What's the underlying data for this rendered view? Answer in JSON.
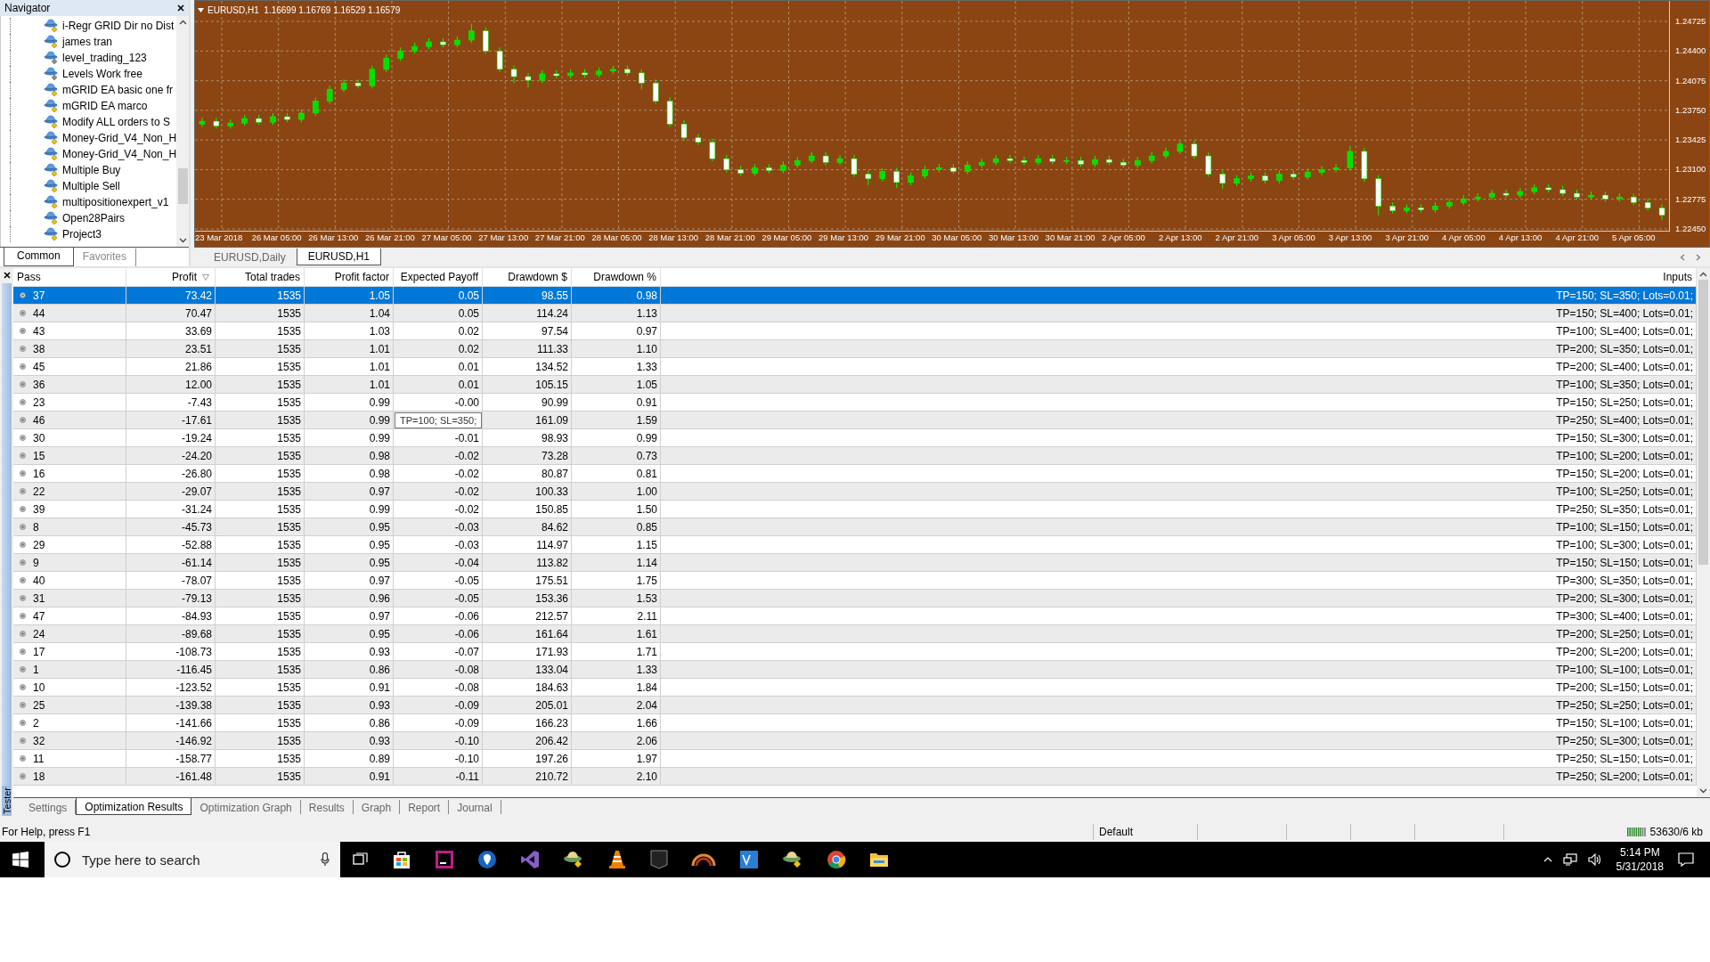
{
  "navigator": {
    "title": "Navigator",
    "items": [
      {
        "label": "i-Regr GRID Dir no Dist",
        "color": "#f2c200"
      },
      {
        "label": "james tran",
        "color": "#f2c200"
      },
      {
        "label": "level_trading_123",
        "color": "#8c8c8c"
      },
      {
        "label": "Levels Work free",
        "color": "#8c8c8c"
      },
      {
        "label": "mGRID EA basic one fr",
        "color": "#f2c200"
      },
      {
        "label": "mGRID EA marco",
        "color": "#f2c200"
      },
      {
        "label": "Modify ALL orders to S",
        "color": "#f2c200"
      },
      {
        "label": "Money-Grid_V4_Non_H",
        "color": "#f2c200"
      },
      {
        "label": "Money-Grid_V4_Non_H",
        "color": "#f2c200"
      },
      {
        "label": "Multiple Buy",
        "color": "#f2c200"
      },
      {
        "label": "Multiple Sell",
        "color": "#f2c200"
      },
      {
        "label": "multipositionexpert_v1",
        "color": "#f2c200"
      },
      {
        "label": "Open28Pairs",
        "color": "#f2c200"
      },
      {
        "label": "Project3",
        "color": "#f2c200"
      }
    ],
    "tabs": [
      {
        "label": "Common",
        "selected": true
      },
      {
        "label": "Favorites",
        "selected": false
      }
    ]
  },
  "chart": {
    "chart_data": {
      "type": "candlestick",
      "title": "EURUSD,H1  1.16699 1.16769 1.16529 1.16579",
      "ylim": [
        1.2245,
        1.2495
      ],
      "yticks": [
        {
          "value": 1.24725,
          "label": "1.24725"
        },
        {
          "value": 1.244,
          "label": "1.24400"
        },
        {
          "value": 1.24075,
          "label": "1.24075"
        },
        {
          "value": 1.2375,
          "label": "1.23750"
        },
        {
          "value": 1.23425,
          "label": "1.23425"
        },
        {
          "value": 1.231,
          "label": "1.23100"
        },
        {
          "value": 1.22775,
          "label": "1.22775"
        },
        {
          "value": 1.2245,
          "label": "1.22450"
        }
      ],
      "grid": true,
      "ohlc": [
        [
          1.236,
          1.2367,
          1.2357,
          1.2363
        ],
        [
          1.2363,
          1.2367,
          1.2355,
          1.2358
        ],
        [
          1.2358,
          1.2365,
          1.2355,
          1.2361
        ],
        [
          1.2361,
          1.237,
          1.2358,
          1.2366
        ],
        [
          1.2366,
          1.237,
          1.2359,
          1.2362
        ],
        [
          1.2362,
          1.2372,
          1.2359,
          1.2368
        ],
        [
          1.2368,
          1.2372,
          1.2362,
          1.2365
        ],
        [
          1.2365,
          1.2376,
          1.2362,
          1.2372
        ],
        [
          1.2372,
          1.2389,
          1.2369,
          1.2385
        ],
        [
          1.2385,
          1.2402,
          1.2382,
          1.2398
        ],
        [
          1.2398,
          1.2409,
          1.2395,
          1.2405
        ],
        [
          1.2405,
          1.2409,
          1.2399,
          1.2402
        ],
        [
          1.2402,
          1.2424,
          1.2399,
          1.242
        ],
        [
          1.242,
          1.2436,
          1.2417,
          1.2432
        ],
        [
          1.2432,
          1.2444,
          1.2429,
          1.244
        ],
        [
          1.244,
          1.2449,
          1.2437,
          1.2445
        ],
        [
          1.2445,
          1.2454,
          1.2442,
          1.245
        ],
        [
          1.245,
          1.2454,
          1.2444,
          1.2447
        ],
        [
          1.2447,
          1.2456,
          1.2444,
          1.2452
        ],
        [
          1.2452,
          1.247,
          1.2449,
          1.2462
        ],
        [
          1.2462,
          1.2466,
          1.2437,
          1.244
        ],
        [
          1.244,
          1.2444,
          1.2417,
          1.242
        ],
        [
          1.242,
          1.2424,
          1.2405,
          1.2412
        ],
        [
          1.2412,
          1.2416,
          1.24,
          1.2408
        ],
        [
          1.2408,
          1.2419,
          1.2405,
          1.2415
        ],
        [
          1.2415,
          1.2419,
          1.241,
          1.2413
        ],
        [
          1.2413,
          1.242,
          1.241,
          1.2416
        ],
        [
          1.2416,
          1.242,
          1.2411,
          1.2414
        ],
        [
          1.2414,
          1.2422,
          1.2411,
          1.2418
        ],
        [
          1.2418,
          1.2424,
          1.2415,
          1.242
        ],
        [
          1.242,
          1.2424,
          1.2413,
          1.2416
        ],
        [
          1.2416,
          1.242,
          1.2398,
          1.2405
        ],
        [
          1.2405,
          1.2409,
          1.2382,
          1.2385
        ],
        [
          1.2385,
          1.2389,
          1.2357,
          1.236
        ],
        [
          1.236,
          1.2364,
          1.2342,
          1.2345
        ],
        [
          1.2345,
          1.2349,
          1.2337,
          1.234
        ],
        [
          1.234,
          1.2344,
          1.2319,
          1.2322
        ],
        [
          1.2322,
          1.2326,
          1.2307,
          1.231
        ],
        [
          1.231,
          1.2314,
          1.2303,
          1.2306
        ],
        [
          1.2306,
          1.2316,
          1.2303,
          1.2312
        ],
        [
          1.2312,
          1.2316,
          1.2306,
          1.2309
        ],
        [
          1.2309,
          1.2319,
          1.2306,
          1.2315
        ],
        [
          1.2315,
          1.2324,
          1.2312,
          1.232
        ],
        [
          1.232,
          1.2329,
          1.2317,
          1.2325
        ],
        [
          1.2325,
          1.2329,
          1.2315,
          1.2318
        ],
        [
          1.2318,
          1.2326,
          1.2315,
          1.2322
        ],
        [
          1.2322,
          1.2326,
          1.2302,
          1.2305
        ],
        [
          1.2305,
          1.2309,
          1.2293,
          1.23
        ],
        [
          1.23,
          1.2312,
          1.2297,
          1.2308
        ],
        [
          1.2308,
          1.2312,
          1.229,
          1.2296
        ],
        [
          1.2296,
          1.2307,
          1.2293,
          1.2303
        ],
        [
          1.2303,
          1.2314,
          1.23,
          1.231
        ],
        [
          1.231,
          1.2316,
          1.2307,
          1.2312
        ],
        [
          1.2312,
          1.2316,
          1.2305,
          1.2308
        ],
        [
          1.2308,
          1.2319,
          1.2305,
          1.2315
        ],
        [
          1.2315,
          1.2322,
          1.2312,
          1.2318
        ],
        [
          1.2318,
          1.2326,
          1.2315,
          1.2322
        ],
        [
          1.2322,
          1.2326,
          1.2317,
          1.232
        ],
        [
          1.232,
          1.2324,
          1.2315,
          1.2318
        ],
        [
          1.2318,
          1.2326,
          1.2315,
          1.2322
        ],
        [
          1.2322,
          1.2326,
          1.2316,
          1.2319
        ],
        [
          1.2319,
          1.2324,
          1.2316,
          1.232
        ],
        [
          1.232,
          1.2324,
          1.2313,
          1.2316
        ],
        [
          1.2316,
          1.2325,
          1.2313,
          1.2321
        ],
        [
          1.2321,
          1.2325,
          1.2315,
          1.2318
        ],
        [
          1.2318,
          1.2322,
          1.2312,
          1.2315
        ],
        [
          1.2315,
          1.2324,
          1.2312,
          1.232
        ],
        [
          1.232,
          1.2329,
          1.2317,
          1.2325
        ],
        [
          1.2325,
          1.2334,
          1.2322,
          1.233
        ],
        [
          1.233,
          1.2342,
          1.2327,
          1.2338
        ],
        [
          1.2338,
          1.2342,
          1.2322,
          1.2325
        ],
        [
          1.2325,
          1.2329,
          1.2302,
          1.2305
        ],
        [
          1.2305,
          1.2309,
          1.2289,
          1.2295
        ],
        [
          1.2295,
          1.2304,
          1.2292,
          1.23
        ],
        [
          1.23,
          1.2307,
          1.2297,
          1.2303
        ],
        [
          1.2303,
          1.2307,
          1.2295,
          1.2298
        ],
        [
          1.2298,
          1.2309,
          1.2295,
          1.2305
        ],
        [
          1.2305,
          1.2309,
          1.2299,
          1.2302
        ],
        [
          1.2302,
          1.2311,
          1.2299,
          1.2307
        ],
        [
          1.2307,
          1.2314,
          1.2304,
          1.231
        ],
        [
          1.231,
          1.2316,
          1.2307,
          1.2312
        ],
        [
          1.2312,
          1.2336,
          1.2309,
          1.233
        ],
        [
          1.233,
          1.2334,
          1.2297,
          1.23
        ],
        [
          1.23,
          1.2304,
          1.226,
          1.227
        ],
        [
          1.227,
          1.2274,
          1.2262,
          1.2265
        ],
        [
          1.2265,
          1.2272,
          1.2262,
          1.2268
        ],
        [
          1.2268,
          1.2272,
          1.2263,
          1.2266
        ],
        [
          1.2266,
          1.2274,
          1.2263,
          1.227
        ],
        [
          1.227,
          1.2278,
          1.2267,
          1.2274
        ],
        [
          1.2274,
          1.2282,
          1.2271,
          1.2278
        ],
        [
          1.2278,
          1.2284,
          1.2275,
          1.228
        ],
        [
          1.228,
          1.2288,
          1.2277,
          1.2284
        ],
        [
          1.2284,
          1.2288,
          1.2279,
          1.2282
        ],
        [
          1.2282,
          1.229,
          1.2279,
          1.2286
        ],
        [
          1.2286,
          1.2294,
          1.2283,
          1.229
        ],
        [
          1.229,
          1.2294,
          1.2285,
          1.2288
        ],
        [
          1.2288,
          1.2292,
          1.2281,
          1.2284
        ],
        [
          1.2284,
          1.2288,
          1.2277,
          1.228
        ],
        [
          1.228,
          1.2286,
          1.2277,
          1.2282
        ],
        [
          1.2282,
          1.2286,
          1.2275,
          1.2278
        ],
        [
          1.2278,
          1.2284,
          1.2275,
          1.228
        ],
        [
          1.228,
          1.2284,
          1.2271,
          1.2274
        ],
        [
          1.2274,
          1.2278,
          1.2265,
          1.2268
        ],
        [
          1.2268,
          1.2272,
          1.2255,
          1.226
        ]
      ]
    },
    "time_labels": [
      "23 Mar 2018",
      "26 Mar 05:00",
      "26 Mar 13:00",
      "26 Mar 21:00",
      "27 Mar 05:00",
      "27 Mar 13:00",
      "27 Mar 21:00",
      "28 Mar 05:00",
      "28 Mar 13:00",
      "28 Mar 21:00",
      "29 Mar 05:00",
      "29 Mar 13:00",
      "29 Mar 21:00",
      "30 Mar 05:00",
      "30 Mar 13:00",
      "30 Mar 21:00",
      "2 Apr 05:00",
      "2 Apr 13:00",
      "2 Apr 21:00",
      "3 Apr 05:00",
      "3 Apr 13:00",
      "3 Apr 21:00",
      "4 Apr 05:00",
      "4 Apr 13:00",
      "4 Apr 21:00",
      "5 Apr 05:00"
    ],
    "tabs": [
      {
        "label": "EURUSD,Daily",
        "selected": false
      },
      {
        "label": "EURUSD,H1",
        "selected": true
      }
    ]
  },
  "tester": {
    "side_label": "Tester",
    "columns": [
      "Pass",
      "Profit",
      "Total trades",
      "Profit factor",
      "Expected Payoff",
      "Drawdown $",
      "Drawdown %",
      "Inputs"
    ],
    "rows": [
      {
        "selected": true,
        "cells": [
          "37",
          "73.42",
          "1535",
          "1.05",
          "0.05",
          "98.55",
          "0.98",
          "TP=150; SL=350; Lots=0.01;"
        ]
      },
      {
        "selected": false,
        "cells": [
          "44",
          "70.47",
          "1535",
          "1.04",
          "0.05",
          "114.24",
          "1.13",
          "TP=150; SL=400; Lots=0.01;"
        ]
      },
      {
        "selected": false,
        "cells": [
          "43",
          "33.69",
          "1535",
          "1.03",
          "0.02",
          "97.54",
          "0.97",
          "TP=100; SL=400; Lots=0.01;"
        ]
      },
      {
        "selected": false,
        "cells": [
          "38",
          "23.51",
          "1535",
          "1.01",
          "0.02",
          "111.33",
          "1.10",
          "TP=200; SL=350; Lots=0.01;"
        ]
      },
      {
        "selected": false,
        "cells": [
          "45",
          "21.86",
          "1535",
          "1.01",
          "0.01",
          "134.52",
          "1.33",
          "TP=200; SL=400; Lots=0.01;"
        ]
      },
      {
        "selected": false,
        "cells": [
          "36",
          "12.00",
          "1535",
          "1.01",
          "0.01",
          "105.15",
          "1.05",
          "TP=100; SL=350; Lots=0.01;"
        ]
      },
      {
        "selected": false,
        "cells": [
          "23",
          "-7.43",
          "1535",
          "0.99",
          "-0.00",
          "90.99",
          "0.91",
          "TP=150; SL=250; Lots=0.01;"
        ]
      },
      {
        "selected": false,
        "cells": [
          "46",
          "-17.61",
          "1535",
          "0.99",
          null,
          "161.09",
          "1.59",
          "TP=250; SL=400; Lots=0.01;"
        ]
      },
      {
        "selected": false,
        "cells": [
          "30",
          "-19.24",
          "1535",
          "0.99",
          "-0.01",
          "98.93",
          "0.99",
          "TP=150; SL=300; Lots=0.01;"
        ]
      },
      {
        "selected": false,
        "cells": [
          "15",
          "-24.20",
          "1535",
          "0.98",
          "-0.02",
          "73.28",
          "0.73",
          "TP=100; SL=200; Lots=0.01;"
        ]
      },
      {
        "selected": false,
        "cells": [
          "16",
          "-26.80",
          "1535",
          "0.98",
          "-0.02",
          "80.87",
          "0.81",
          "TP=150; SL=200; Lots=0.01;"
        ]
      },
      {
        "selected": false,
        "cells": [
          "22",
          "-29.07",
          "1535",
          "0.97",
          "-0.02",
          "100.33",
          "1.00",
          "TP=100; SL=250; Lots=0.01;"
        ]
      },
      {
        "selected": false,
        "cells": [
          "39",
          "-31.24",
          "1535",
          "0.99",
          "-0.02",
          "150.85",
          "1.50",
          "TP=250; SL=350; Lots=0.01;"
        ]
      },
      {
        "selected": false,
        "cells": [
          "8",
          "-45.73",
          "1535",
          "0.95",
          "-0.03",
          "84.62",
          "0.85",
          "TP=100; SL=150; Lots=0.01;"
        ]
      },
      {
        "selected": false,
        "cells": [
          "29",
          "-52.88",
          "1535",
          "0.95",
          "-0.03",
          "114.97",
          "1.15",
          "TP=100; SL=300; Lots=0.01;"
        ]
      },
      {
        "selected": false,
        "cells": [
          "9",
          "-61.14",
          "1535",
          "0.95",
          "-0.04",
          "113.82",
          "1.14",
          "TP=150; SL=150; Lots=0.01;"
        ]
      },
      {
        "selected": false,
        "cells": [
          "40",
          "-78.07",
          "1535",
          "0.97",
          "-0.05",
          "175.51",
          "1.75",
          "TP=300; SL=350; Lots=0.01;"
        ]
      },
      {
        "selected": false,
        "cells": [
          "31",
          "-79.13",
          "1535",
          "0.96",
          "-0.05",
          "153.36",
          "1.53",
          "TP=200; SL=300; Lots=0.01;"
        ]
      },
      {
        "selected": false,
        "cells": [
          "47",
          "-84.93",
          "1535",
          "0.97",
          "-0.06",
          "212.57",
          "2.11",
          "TP=300; SL=400; Lots=0.01;"
        ]
      },
      {
        "selected": false,
        "cells": [
          "24",
          "-89.68",
          "1535",
          "0.95",
          "-0.06",
          "161.64",
          "1.61",
          "TP=200; SL=250; Lots=0.01;"
        ]
      },
      {
        "selected": false,
        "cells": [
          "17",
          "-108.73",
          "1535",
          "0.93",
          "-0.07",
          "171.93",
          "1.71",
          "TP=200; SL=200; Lots=0.01;"
        ]
      },
      {
        "selected": false,
        "cells": [
          "1",
          "-116.45",
          "1535",
          "0.86",
          "-0.08",
          "133.04",
          "1.33",
          "TP=100; SL=100; Lots=0.01;"
        ]
      },
      {
        "selected": false,
        "cells": [
          "10",
          "-123.52",
          "1535",
          "0.91",
          "-0.08",
          "184.63",
          "1.84",
          "TP=200; SL=150; Lots=0.01;"
        ]
      },
      {
        "selected": false,
        "cells": [
          "25",
          "-139.38",
          "1535",
          "0.93",
          "-0.09",
          "205.01",
          "2.04",
          "TP=250; SL=250; Lots=0.01;"
        ]
      },
      {
        "selected": false,
        "cells": [
          "2",
          "-141.66",
          "1535",
          "0.86",
          "-0.09",
          "166.23",
          "1.66",
          "TP=150; SL=100; Lots=0.01;"
        ]
      },
      {
        "selected": false,
        "cells": [
          "32",
          "-146.92",
          "1535",
          "0.93",
          "-0.10",
          "206.42",
          "2.06",
          "TP=250; SL=300; Lots=0.01;"
        ]
      },
      {
        "selected": false,
        "cells": [
          "11",
          "-158.77",
          "1535",
          "0.89",
          "-0.10",
          "197.26",
          "1.97",
          "TP=250; SL=150; Lots=0.01;"
        ]
      },
      {
        "selected": false,
        "cells": [
          "18",
          "-161.48",
          "1535",
          "0.91",
          "-0.11",
          "210.72",
          "2.10",
          "TP=250; SL=200; Lots=0.01;"
        ]
      }
    ],
    "tooltip": "TP=100; SL=350;",
    "tabs": [
      {
        "label": "Settings",
        "selected": false
      },
      {
        "label": "Optimization Results",
        "selected": true
      },
      {
        "label": "Optimization Graph",
        "selected": false
      },
      {
        "label": "Results",
        "selected": false
      },
      {
        "label": "Graph",
        "selected": false
      },
      {
        "label": "Report",
        "selected": false
      },
      {
        "label": "Journal",
        "selected": false
      }
    ]
  },
  "status_bar": {
    "help": "For Help, press F1",
    "profile": "Default",
    "memory": "53630/6 kb"
  },
  "taskbar": {
    "search_placeholder": "Type here to search",
    "time": "5:14 PM",
    "date": "5/31/2018"
  }
}
